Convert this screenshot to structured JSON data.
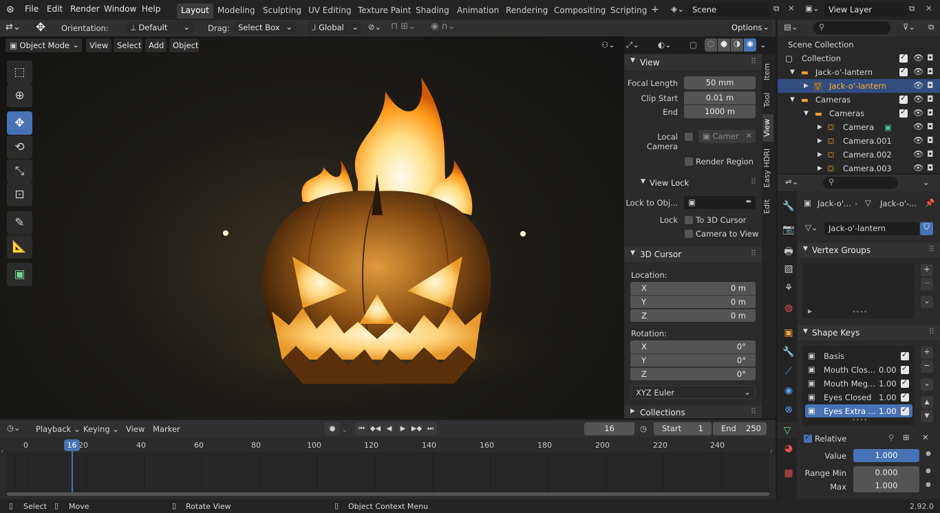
{
  "topbar": {
    "menus": [
      "File",
      "Edit",
      "Render",
      "Window",
      "Help"
    ],
    "workspaces": [
      "Layout",
      "Modeling",
      "Sculpting",
      "UV Editing",
      "Texture Paint",
      "Shading",
      "Animation",
      "Rendering",
      "Compositing",
      "Scripting"
    ],
    "active_workspace": "Layout",
    "add_tab": "+",
    "scene": "Scene",
    "view_layer": "View Layer"
  },
  "tool_header": {
    "orientation_label": "Orientation:",
    "orientation_value": "Default",
    "drag_label": "Drag:",
    "drag_value": "Select Box",
    "transform_orientation": "Global",
    "options": "Options"
  },
  "viewport_header": {
    "mode": "Object Mode",
    "menus": [
      "View",
      "Select",
      "Add",
      "Object"
    ]
  },
  "npanel": {
    "tabs": [
      "Item",
      "Tool",
      "View",
      "Easy HDRI",
      "Edit"
    ],
    "active_tab": "View",
    "view": {
      "title": "View",
      "focal_length_label": "Focal Length",
      "focal_length": "50 mm",
      "clip_start_label": "Clip Start",
      "clip_start": "0.01 m",
      "end_label": "End",
      "end": "1000 m",
      "local_camera_label": "Local Camera",
      "local_camera_value": "Camer",
      "render_region": "Render Region",
      "view_lock_title": "View Lock",
      "lock_to_obj_label": "Lock to Obj...",
      "lock_label": "Lock",
      "to_3d_cursor": "To 3D Cursor",
      "camera_to_view": "Camera to View"
    },
    "cursor": {
      "title": "3D Cursor",
      "location_label": "Location:",
      "rotation_label": "Rotation:",
      "location": [
        {
          "axis": "X",
          "value": "0 m"
        },
        {
          "axis": "Y",
          "value": "0 m"
        },
        {
          "axis": "Z",
          "value": "0 m"
        }
      ],
      "rotation": [
        {
          "axis": "X",
          "value": "0°"
        },
        {
          "axis": "Y",
          "value": "0°"
        },
        {
          "axis": "Z",
          "value": "0°"
        }
      ],
      "rotation_mode": "XYZ Euler"
    },
    "collections_title": "Collections"
  },
  "outliner": {
    "root": "Scene Collection",
    "rows": [
      {
        "label": "Collection",
        "icon": "collection-icon"
      },
      {
        "label": "Jack-o'-lantern",
        "icon": "collection-icon"
      },
      {
        "label": "Jack-o'-lantern",
        "icon": "mesh-icon",
        "selected": true
      },
      {
        "label": "Cameras",
        "icon": "collection-icon"
      },
      {
        "label": "Cameras",
        "icon": "collection-icon"
      },
      {
        "label": "Camera",
        "icon": "camera-icon"
      },
      {
        "label": "Camera.001",
        "icon": "camera-icon"
      },
      {
        "label": "Camera.002",
        "icon": "camera-icon"
      },
      {
        "label": "Camera.003",
        "icon": "camera-icon"
      }
    ]
  },
  "properties": {
    "breadcrumb_object": "Jack-o'...",
    "breadcrumb_data": "Jack-o'-...",
    "mesh_name": "Jack-o'-lantern",
    "vertex_groups_title": "Vertex Groups",
    "shape_keys_title": "Shape Keys",
    "shape_keys": [
      {
        "name": "Basis",
        "value": ""
      },
      {
        "name": "Mouth Clos...",
        "value": "0.00"
      },
      {
        "name": "Mouth Meg...",
        "value": "1.00"
      },
      {
        "name": "Eyes Closed",
        "value": "1.00"
      },
      {
        "name": "Eyes Extra ...",
        "value": "1.00"
      }
    ],
    "relative_label": "Relative",
    "value_label": "Value",
    "value": "1.000",
    "range_min_label": "Range Min",
    "range_min": "0.000",
    "max_label": "Max",
    "max": "1.000"
  },
  "timeline": {
    "menus": [
      "Playback",
      "Keying",
      "View",
      "Marker"
    ],
    "current_frame": "16",
    "start_label": "Start",
    "start": "1",
    "end_label": "End",
    "end": "250",
    "ticks": [
      "0",
      "20",
      "40",
      "60",
      "80",
      "100",
      "120",
      "140",
      "160",
      "180",
      "200",
      "220",
      "240"
    ]
  },
  "statusbar": {
    "select": "Select",
    "move": "Move",
    "rotate": "Rotate View",
    "context": "Object Context Menu",
    "version": "2.92.0"
  },
  "colors": {
    "accent": "#4772b3",
    "selected_text": "#ffaf29",
    "bg": "#1d1d1d"
  }
}
